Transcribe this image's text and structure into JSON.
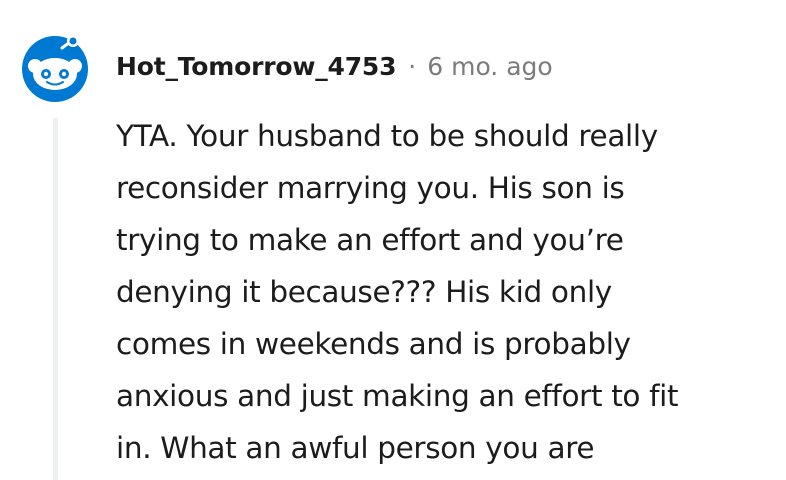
{
  "comment": {
    "author": "Hot_Tomorrow_4753",
    "separator": "·",
    "timestamp": "6 mo. ago",
    "avatar_icon": "snoo-avatar-icon",
    "body_lines": [
      "YTA. Your husband to be should really",
      "reconsider marrying you. His son is",
      "trying to make an effort and you’re",
      "denying it because??? His kid only",
      "comes in weekends and is probably",
      "anxious and just making an effort to fit",
      "in. What an awful person you are"
    ]
  },
  "colors": {
    "avatar_background": "#0079d3",
    "text": "#1c1c1c",
    "meta_text": "#7c7c7c",
    "thread_line": "#edeff1"
  }
}
